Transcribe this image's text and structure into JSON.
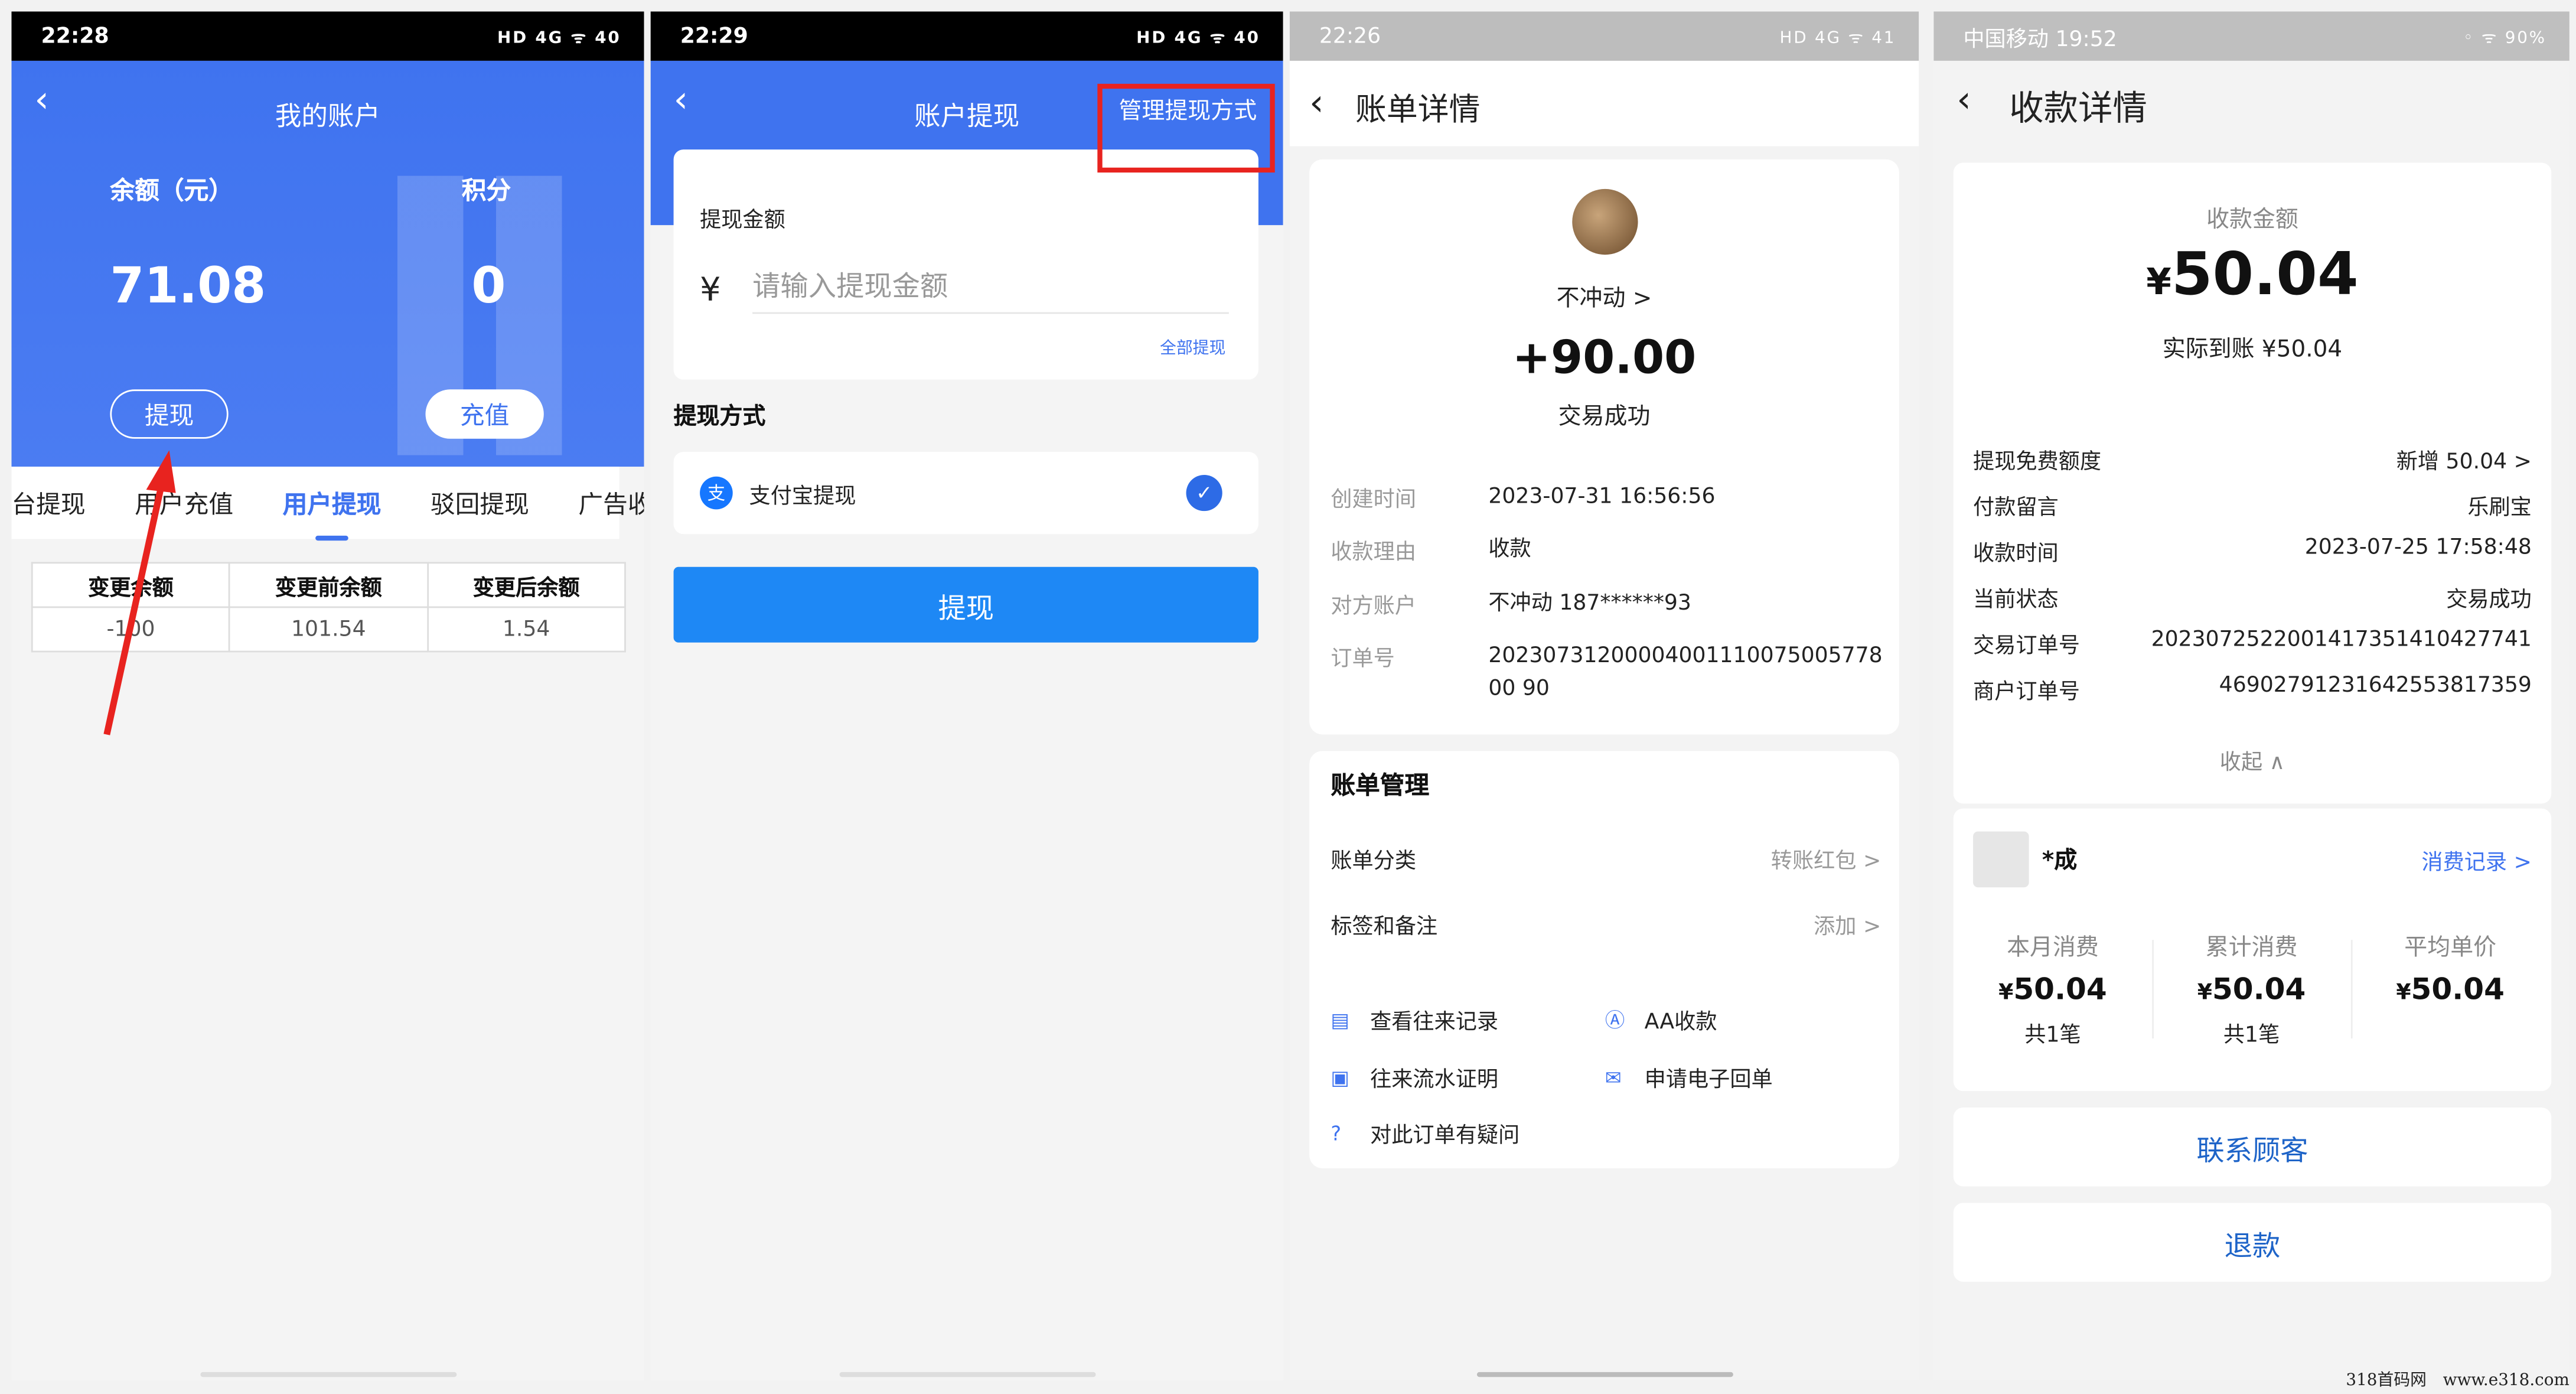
{
  "phone1": {
    "time": "22:28",
    "status_icons": "HD 4G ᯤ 40",
    "title": "我的账户",
    "balance_label": "余额（元）",
    "points_label": "积分",
    "balance_value": "71.08",
    "points_value": "0",
    "withdraw_button": "提现",
    "recharge_button": "充值",
    "tabs": [
      "台提现",
      "用户充值",
      "用户提现",
      "驳回提现",
      "广告收"
    ],
    "active_tab": "用户提现",
    "table_headers": [
      "变更余额",
      "变更前余额",
      "变更后余额"
    ],
    "table_row": [
      "-100",
      "101.54",
      "1.54"
    ]
  },
  "phone2": {
    "time": "22:29",
    "status_icons": "HD 4G ᯤ 40",
    "title": "账户提现",
    "manage_link": "管理提现方式",
    "amount_label": "提现金额",
    "currency": "¥",
    "amount_placeholder": "请输入提现金额",
    "withdraw_all": "全部提现",
    "method_title": "提现方式",
    "method_name": "支付宝提现",
    "alipay_glyph": "支",
    "submit_button": "提现"
  },
  "phone3": {
    "time": "22:26",
    "status_icons": "HD 4G ᯤ 41",
    "title": "账单详情",
    "name": "不冲动 >",
    "amount": "+90.00",
    "status": "交易成功",
    "rows": [
      {
        "k": "创建时间",
        "v": "2023-07-31 16:56:56"
      },
      {
        "k": "收款理由",
        "v": "收款"
      },
      {
        "k": "对方账户",
        "v": "不冲动 187******93"
      },
      {
        "k": "订单号",
        "v": "2023073120000400111007500577800 90"
      }
    ],
    "manage_title": "账单管理",
    "category_label": "账单分类",
    "category_value": "转账红包 >",
    "tag_label": "标签和备注",
    "tag_value": "添加 >",
    "actions": [
      "查看往来记录",
      "AA收款",
      "往来流水证明",
      "申请电子回单",
      "对此订单有疑问"
    ]
  },
  "phone4": {
    "time": "中国移动 19:52",
    "status_icons": "◦ ᯤ 90%",
    "title": "收款详情",
    "amount_label": "收款金额",
    "currency": "¥",
    "amount": "50.04",
    "actual": "实际到账 ¥50.04",
    "rows": [
      {
        "k": "提现免费额度",
        "v": "新增 50.04 >"
      },
      {
        "k": "付款留言",
        "v": "乐刷宝"
      },
      {
        "k": "收款时间",
        "v": "2023-07-25 17:58:48"
      },
      {
        "k": "当前状态",
        "v": "交易成功"
      },
      {
        "k": "交易订单号",
        "v": "2023072522001417351410427741"
      },
      {
        "k": "商户订单号",
        "v": "46902791231642553817359"
      }
    ],
    "fold": "收起 ∧",
    "customer_name": "*成",
    "records_link": "消费记录 >",
    "stats": [
      {
        "label": "本月消费",
        "value": "50.04",
        "count": "共1笔"
      },
      {
        "label": "累计消费",
        "value": "50.04",
        "count": "共1笔"
      },
      {
        "label": "平均单价",
        "value": "50.04",
        "count": ""
      }
    ],
    "contact_button": "联系顾客",
    "refund_button": "退款"
  },
  "watermark": "318首码网　www.e318.com",
  "colors": {
    "primary_blue": "#3f73ef",
    "button_blue": "#1e88f5",
    "highlight_red": "#e8231f"
  }
}
